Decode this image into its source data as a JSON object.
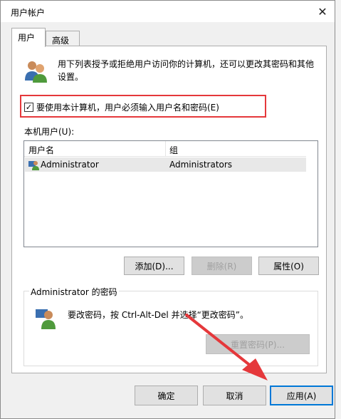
{
  "window": {
    "title": "用户帐户",
    "close_glyph": "✕"
  },
  "tabs": [
    {
      "label": "用户",
      "active": true
    },
    {
      "label": "高级",
      "active": false
    }
  ],
  "intro_text": "用下列表授予或拒绝用户访问你的计算机，还可以更改其密码和其他设置。",
  "require_login_checkbox": {
    "label": "要使用本计算机，用户必须输入用户名和密码(E)",
    "checked": true,
    "glyph": "✓"
  },
  "local_users": {
    "label": "本机用户(U):",
    "columns": [
      "用户名",
      "组"
    ],
    "rows": [
      {
        "user": "Administrator",
        "group": "Administrators"
      }
    ]
  },
  "user_buttons": {
    "add": "添加(D)...",
    "delete": "删除(R)",
    "properties": "属性(O)"
  },
  "password_group": {
    "title": "Administrator 的密码",
    "text": "要改密码，按 Ctrl-Alt-Del 并选择“更改密码”。",
    "reset_button": "重置密码(P)..."
  },
  "footer_buttons": {
    "ok": "确定",
    "cancel": "取消",
    "apply": "应用(A)"
  },
  "colors": {
    "highlight": "#e5383b",
    "arrow": "#e5383b",
    "accent": "#0078d7"
  },
  "icons": {
    "users": "users-icon",
    "user_row": "user-icon",
    "password": "user-key-icon",
    "close": "close-icon"
  }
}
